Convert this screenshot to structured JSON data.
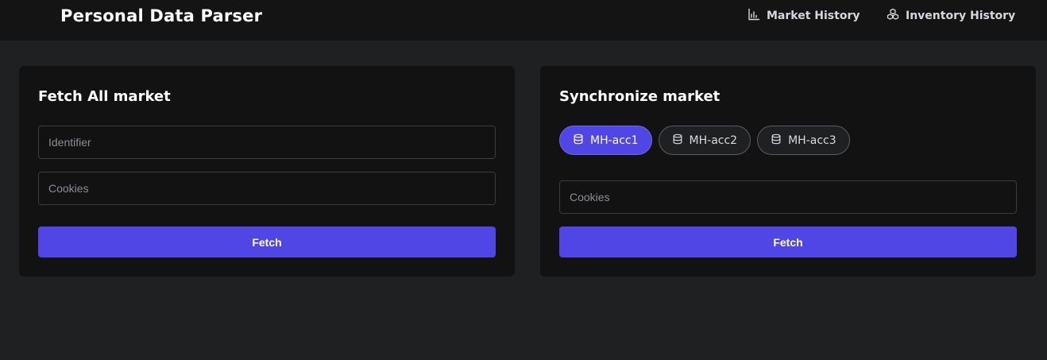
{
  "app": {
    "title": "Personal Data Parser"
  },
  "nav": {
    "market_history": {
      "label": "Market History",
      "icon": "bar-chart-icon"
    },
    "inventory_history": {
      "label": "Inventory History",
      "icon": "cubes-icon"
    }
  },
  "fetch_all": {
    "title": "Fetch All market",
    "identifier_placeholder": "Identifier",
    "cookies_placeholder": "Cookies",
    "button_label": "Fetch"
  },
  "synchronize": {
    "title": "Synchronize market",
    "accounts": [
      {
        "label": "MH-acc1",
        "selected": true,
        "icon": "database-icon"
      },
      {
        "label": "MH-acc2",
        "selected": false,
        "icon": "database-icon"
      },
      {
        "label": "MH-acc3",
        "selected": false,
        "icon": "database-icon"
      }
    ],
    "cookies_placeholder": "Cookies",
    "button_label": "Fetch"
  },
  "colors": {
    "accent": "#4f46e5",
    "background": "#1f2022",
    "card": "#121212",
    "topbar": "#141414"
  }
}
